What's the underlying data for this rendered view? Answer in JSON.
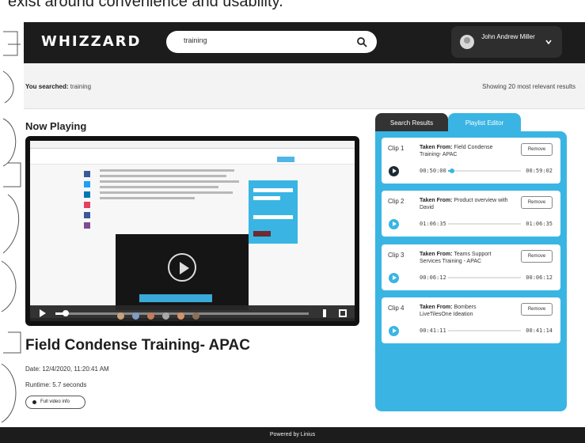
{
  "caption": "exist around convenience and usability.",
  "app": {
    "logo": "WHIZZARD"
  },
  "search": {
    "value": "training"
  },
  "user": {
    "name": "John Andrew Miller"
  },
  "results_bar": {
    "label": "You searched:",
    "query": "training",
    "summary": "Showing 20 most relevant results"
  },
  "now_playing": {
    "heading": "Now Playing",
    "title": "Field Condense Training- APAC",
    "date": "Date: 12/4/2020, 11:20:41 AM",
    "runtime": "Runtime: 5.7 seconds",
    "full_info_label": "Full video info",
    "progress": 0.04
  },
  "panel": {
    "tabs": [
      "Search Results",
      "Playlist Editor"
    ],
    "active_tab": "Playlist Editor",
    "clips": [
      {
        "label": "Clip 1",
        "from_label": "Taken From:",
        "source": "Field Condense Training- APAC",
        "remove": "Remove",
        "start": "00:50:00",
        "end": "00:59:02",
        "playing": true,
        "progress": 0.05
      },
      {
        "label": "Clip 2",
        "from_label": "Taken From:",
        "source": "Product overview with David",
        "remove": "Remove",
        "start": "01:06:35",
        "end": "01:06:35",
        "playing": false,
        "progress": 0
      },
      {
        "label": "Clip 3",
        "from_label": "Taken From:",
        "source": "Teams Support Services Training - APAC",
        "remove": "Remove",
        "start": "00:06:12",
        "end": "00:06:12",
        "playing": false,
        "progress": 0
      },
      {
        "label": "Clip 4",
        "from_label": "Taken From:",
        "source": "Bombers LiveTilesOne Ideation",
        "remove": "Remove",
        "start": "00:41:11",
        "end": "00:41:14",
        "playing": false,
        "progress": 0
      }
    ]
  },
  "footer": {
    "text": "Powered by Linius"
  },
  "colors": {
    "accent": "#3ab5e3",
    "dark": "#1c1c1c"
  }
}
